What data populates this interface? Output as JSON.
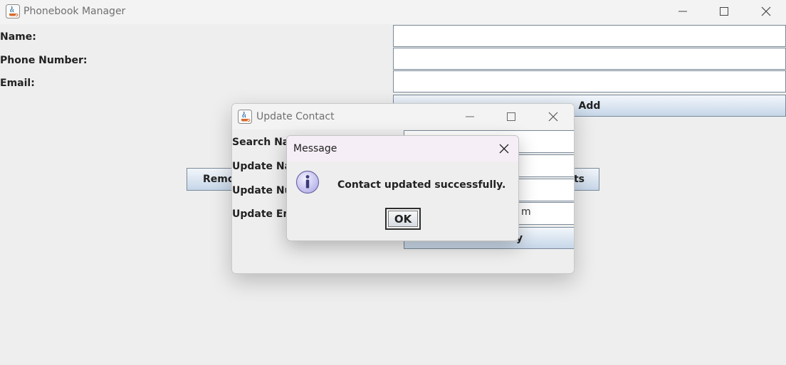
{
  "main_window": {
    "title": "Phonebook Manager",
    "labels": {
      "name": "Name:",
      "phone": "Phone Number:",
      "email": "Email:"
    },
    "fields": {
      "name": "",
      "phone": "",
      "email": ""
    },
    "buttons": {
      "add": "Add",
      "remove_partial": "Remo",
      "view_contacts_partial": "ts"
    }
  },
  "update_dialog": {
    "title": "Update Contact",
    "labels": {
      "search_name": "Search Nar",
      "update_name": "Update Nar",
      "update_number": "Update Nur",
      "update_email": "Update Em"
    },
    "fields": {
      "search_name": "",
      "update_name": "",
      "update_number": "",
      "update_email": "m"
    },
    "buttons": {
      "update": "y"
    }
  },
  "message_dialog": {
    "title": "Message",
    "text": "Contact updated successfully.",
    "ok_label": "OK",
    "icon": "info-icon"
  },
  "window_controls": {
    "minimize": "minimize-icon",
    "maximize": "maximize-icon",
    "close": "close-icon"
  },
  "colors": {
    "window_bg": "#eeeeee",
    "button_gradient_top": "#f2f6fb",
    "button_gradient_bottom": "#c6d6e8",
    "message_titlebar": "#f6eef6",
    "info_icon_fill": "#c9c6ef"
  }
}
